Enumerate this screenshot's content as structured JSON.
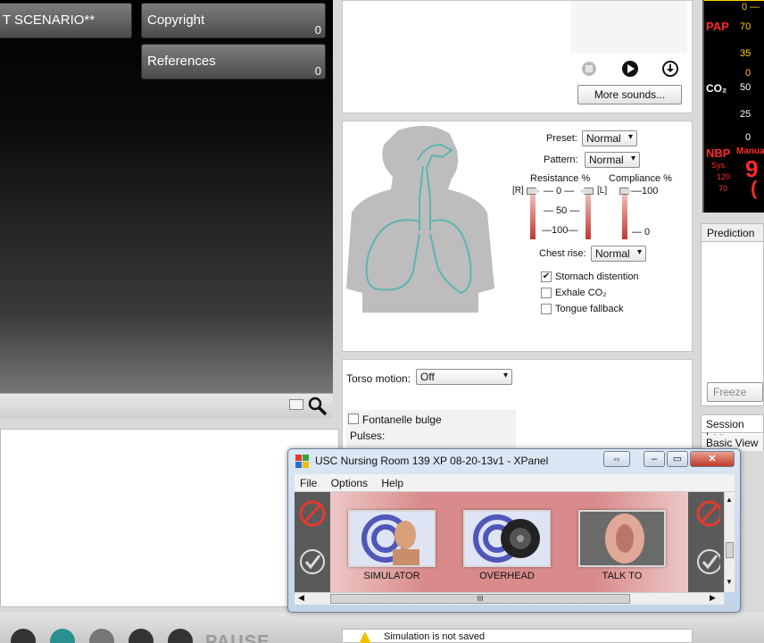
{
  "left": {
    "scenario_btn": "T SCENARIO**",
    "copyright_label": "Copyright",
    "copyright_count": "0",
    "references_label": "References",
    "references_count": "0"
  },
  "sounds": {
    "more_sounds": "More sounds..."
  },
  "airway": {
    "preset_label": "Preset:",
    "preset_value": "Normal",
    "pattern_label": "Pattern:",
    "pattern_value": "Normal",
    "resistance_label": "Resistance %",
    "compliance_label": "Compliance %",
    "r_tag": "[R]",
    "l_tag": "[L]",
    "res_ticks": [
      "— 0 —",
      "— 50 —",
      "—100—"
    ],
    "comp_ticks": [
      "—100",
      "— 0"
    ],
    "chest_rise_label": "Chest rise:",
    "chest_rise_value": "Normal",
    "stomach_label": "Stomach distention",
    "stomach_checked": true,
    "exhale_label": "Exhale CO₂",
    "exhale_checked": false,
    "tongue_label": "Tongue fallback",
    "tongue_checked": false
  },
  "torso": {
    "torso_label": "Torso motion:",
    "torso_value": "Off",
    "fontanelle_label": "Fontanelle bulge",
    "pulses_label": "Pulses:"
  },
  "monitor": {
    "pap_label": "PAP",
    "pap_scale": [
      "70",
      "35",
      "0"
    ],
    "co2_label": "CO₂",
    "co2_scale": [
      "50",
      "25",
      "0"
    ],
    "nbp_label": "NBP",
    "nbp_manual": "Manua",
    "nbp_sys": "Sys.",
    "nbp_120": "120",
    "nbp_70": "70",
    "nbp_big": "9",
    "nbp_paren": "("
  },
  "right": {
    "prediction_tab": "Prediction",
    "freeze_btn": "Freeze",
    "session_log_tab": "Session Log",
    "basic_view_tab": "Basic View"
  },
  "bottom": {
    "pause_label": "PAUSE",
    "status": "Simulation is not saved"
  },
  "xpanel": {
    "title": "USC Nursing Room 139 XP 08-20-13v1 - XPanel",
    "menu": [
      "File",
      "Options",
      "Help"
    ],
    "tiles": [
      "SIMULATOR",
      "OVERHEAD",
      "TALK TO"
    ],
    "scroll_grip": "III"
  },
  "colors": {
    "alert_red": "#ff2a2a",
    "scale_yellow": "#ffd200",
    "slider_red": "#c0392b"
  }
}
